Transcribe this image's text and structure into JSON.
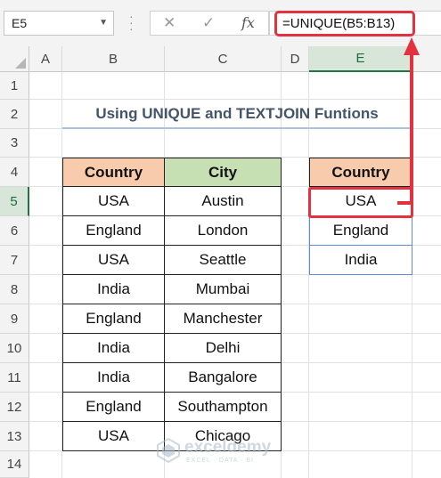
{
  "formula_bar": {
    "name_box": "E5",
    "formula": "=UNIQUE(B5:B13)",
    "cancel_icon": "✕",
    "enter_icon": "✓",
    "fx_label": "fx"
  },
  "columns": [
    "A",
    "B",
    "C",
    "D",
    "E"
  ],
  "rows": [
    "1",
    "2",
    "3",
    "4",
    "5",
    "6",
    "7",
    "8",
    "9",
    "10",
    "11",
    "12",
    "13",
    "14"
  ],
  "title": "Using UNIQUE and TEXTJOIN Funtions",
  "source_table": {
    "headers": [
      "Country",
      "City"
    ],
    "rows": [
      [
        "USA",
        "Austin"
      ],
      [
        "England",
        "London"
      ],
      [
        "USA",
        "Seattle"
      ],
      [
        "India",
        "Mumbai"
      ],
      [
        "England",
        "Manchester"
      ],
      [
        "India",
        "Delhi"
      ],
      [
        "India",
        "Bangalore"
      ],
      [
        "England",
        "Southampton"
      ],
      [
        "USA",
        "Chicago"
      ]
    ]
  },
  "unique_table": {
    "header": "Country",
    "values": [
      "USA",
      "England",
      "India"
    ]
  },
  "watermark": {
    "name": "exceldemy",
    "tagline": "EXCEL · DATA · BI"
  },
  "colors": {
    "accent_red": "#e2323f",
    "country_header": "#f8cbad",
    "city_header": "#c6e0b4",
    "title_text": "#44546a",
    "excel_green": "#217346"
  }
}
